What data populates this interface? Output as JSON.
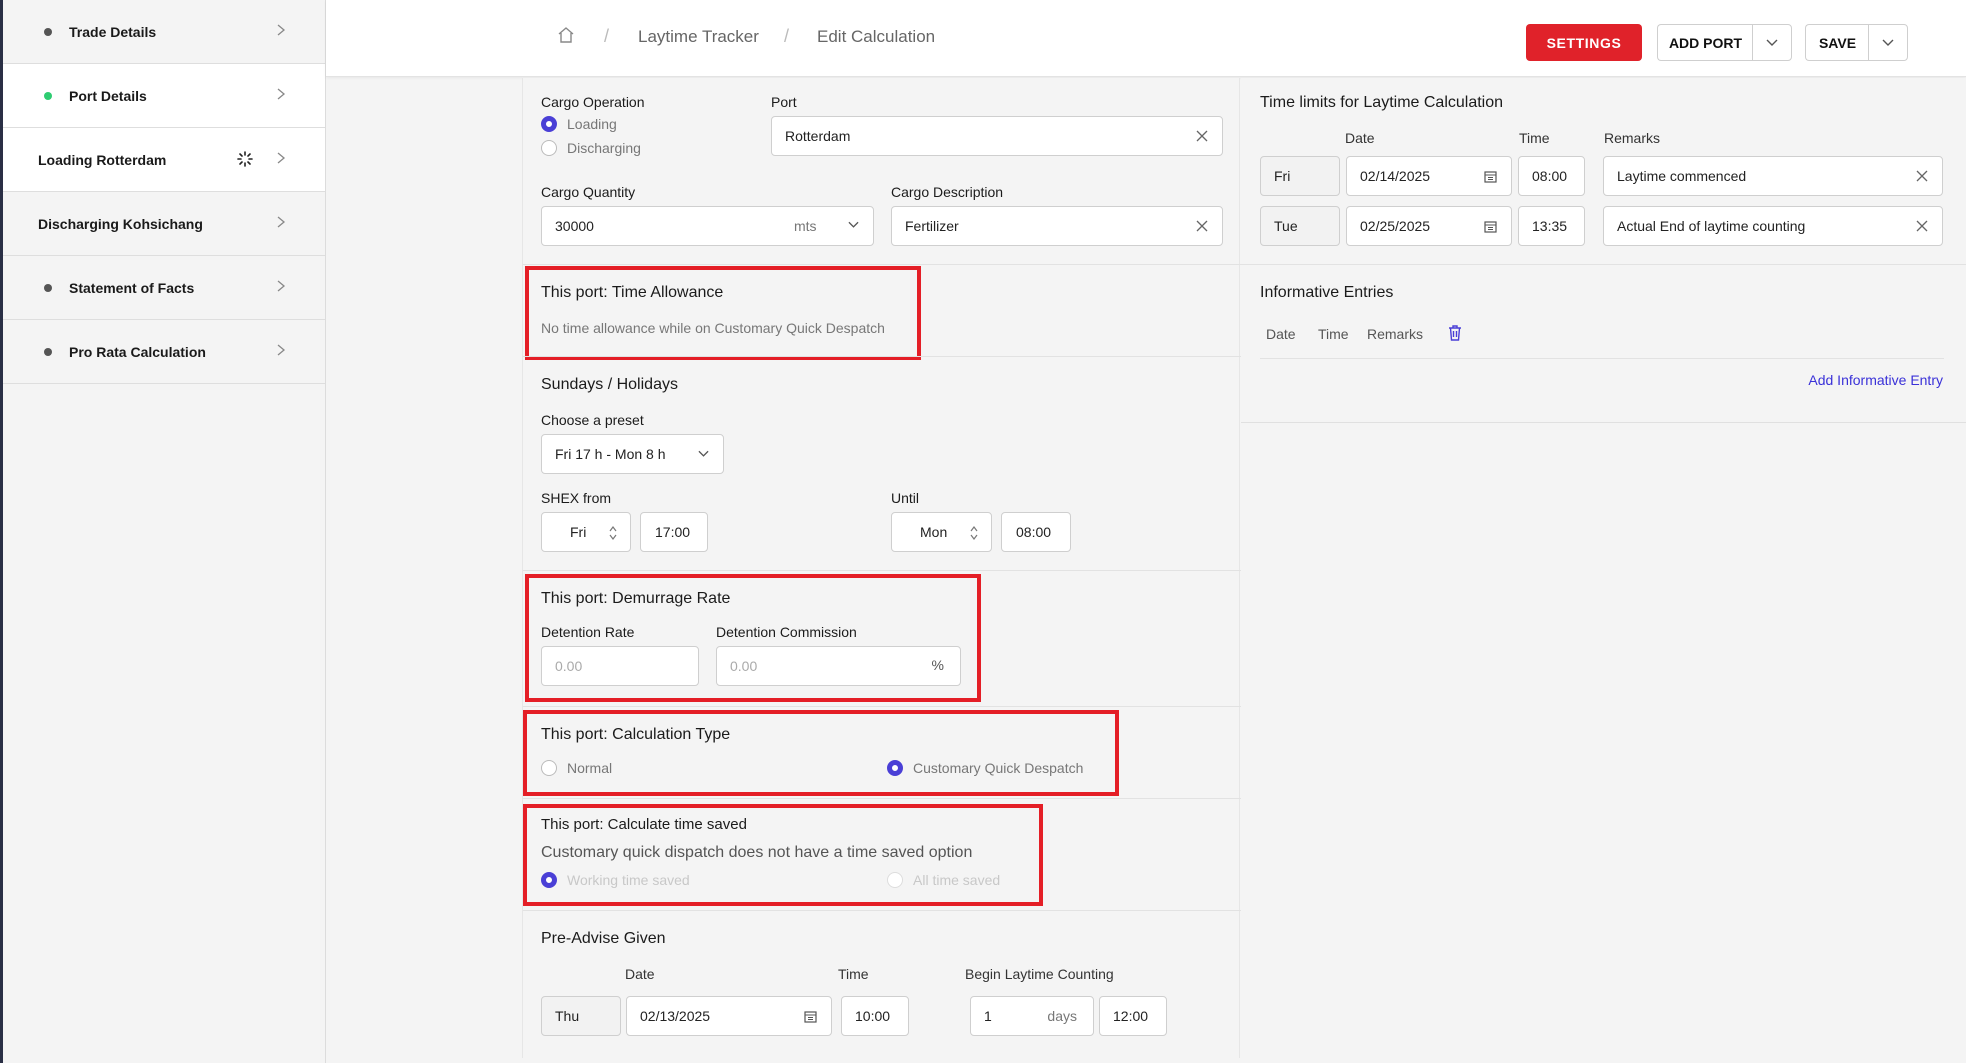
{
  "sidebar": {
    "items": [
      {
        "label": "Trade Details"
      },
      {
        "label": "Port Details"
      },
      {
        "label": "Loading Rotterdam"
      },
      {
        "label": "Discharging Kohsichang"
      },
      {
        "label": "Statement of Facts"
      },
      {
        "label": "Pro Rata Calculation"
      }
    ]
  },
  "header": {
    "breadcrumb": [
      "Laytime Tracker",
      "Edit Calculation"
    ],
    "settings_label": "SETTINGS",
    "add_port_label": "ADD PORT",
    "save_label": "SAVE"
  },
  "cargo": {
    "operation_label": "Cargo Operation",
    "options": [
      "Loading",
      "Discharging"
    ],
    "selected": "Loading",
    "port_label": "Port",
    "port_value": "Rotterdam",
    "quantity_label": "Cargo Quantity",
    "quantity_value": "30000",
    "quantity_unit": "mts",
    "description_label": "Cargo Description",
    "description_value": "Fertilizer"
  },
  "time_allowance": {
    "title": "This port: Time Allowance",
    "note": "No time allowance while on Customary Quick Despatch"
  },
  "sundays": {
    "title": "Sundays / Holidays",
    "preset_label": "Choose a preset",
    "preset_value": "Fri 17 h - Mon 8 h",
    "shex_from_label": "SHEX from",
    "from_day": "Fri",
    "from_time": "17:00",
    "until_label": "Until",
    "until_day": "Mon",
    "until_time": "08:00"
  },
  "demurrage": {
    "title": "This port: Demurrage Rate",
    "rate_label": "Detention Rate",
    "rate_placeholder": "0.00",
    "commission_label": "Detention Commission",
    "commission_placeholder": "0.00",
    "commission_unit": "%"
  },
  "calc_type": {
    "title": "This port: Calculation Type",
    "options": [
      "Normal",
      "Customary Quick Despatch"
    ],
    "selected": "Customary Quick Despatch"
  },
  "time_saved": {
    "title": "This port: Calculate time saved",
    "note": "Customary quick dispatch does not have a time saved option",
    "options": [
      "Working time saved",
      "All time saved"
    ],
    "selected": "Working time saved"
  },
  "pre_advise": {
    "title": "Pre-Advise Given",
    "date_label": "Date",
    "time_label": "Time",
    "begin_label": "Begin Laytime Counting",
    "day": "Thu",
    "date": "02/13/2025",
    "time": "10:00",
    "days_value": "1",
    "days_unit": "days",
    "begin_time": "12:00"
  },
  "time_limits": {
    "title": "Time limits for Laytime Calculation",
    "col_date": "Date",
    "col_time": "Time",
    "col_remarks": "Remarks",
    "rows": [
      {
        "day": "Fri",
        "date": "02/14/2025",
        "time": "08:00",
        "remarks": "Laytime commenced"
      },
      {
        "day": "Tue",
        "date": "02/25/2025",
        "time": "13:35",
        "remarks": "Actual End of laytime counting"
      }
    ]
  },
  "informative": {
    "title": "Informative Entries",
    "col_date": "Date",
    "col_time": "Time",
    "col_remarks": "Remarks",
    "add_label": "Add Informative Entry"
  },
  "colors": {
    "accent": "#4a3fd6",
    "danger": "#e0222a",
    "highlight": "#e41e26"
  }
}
